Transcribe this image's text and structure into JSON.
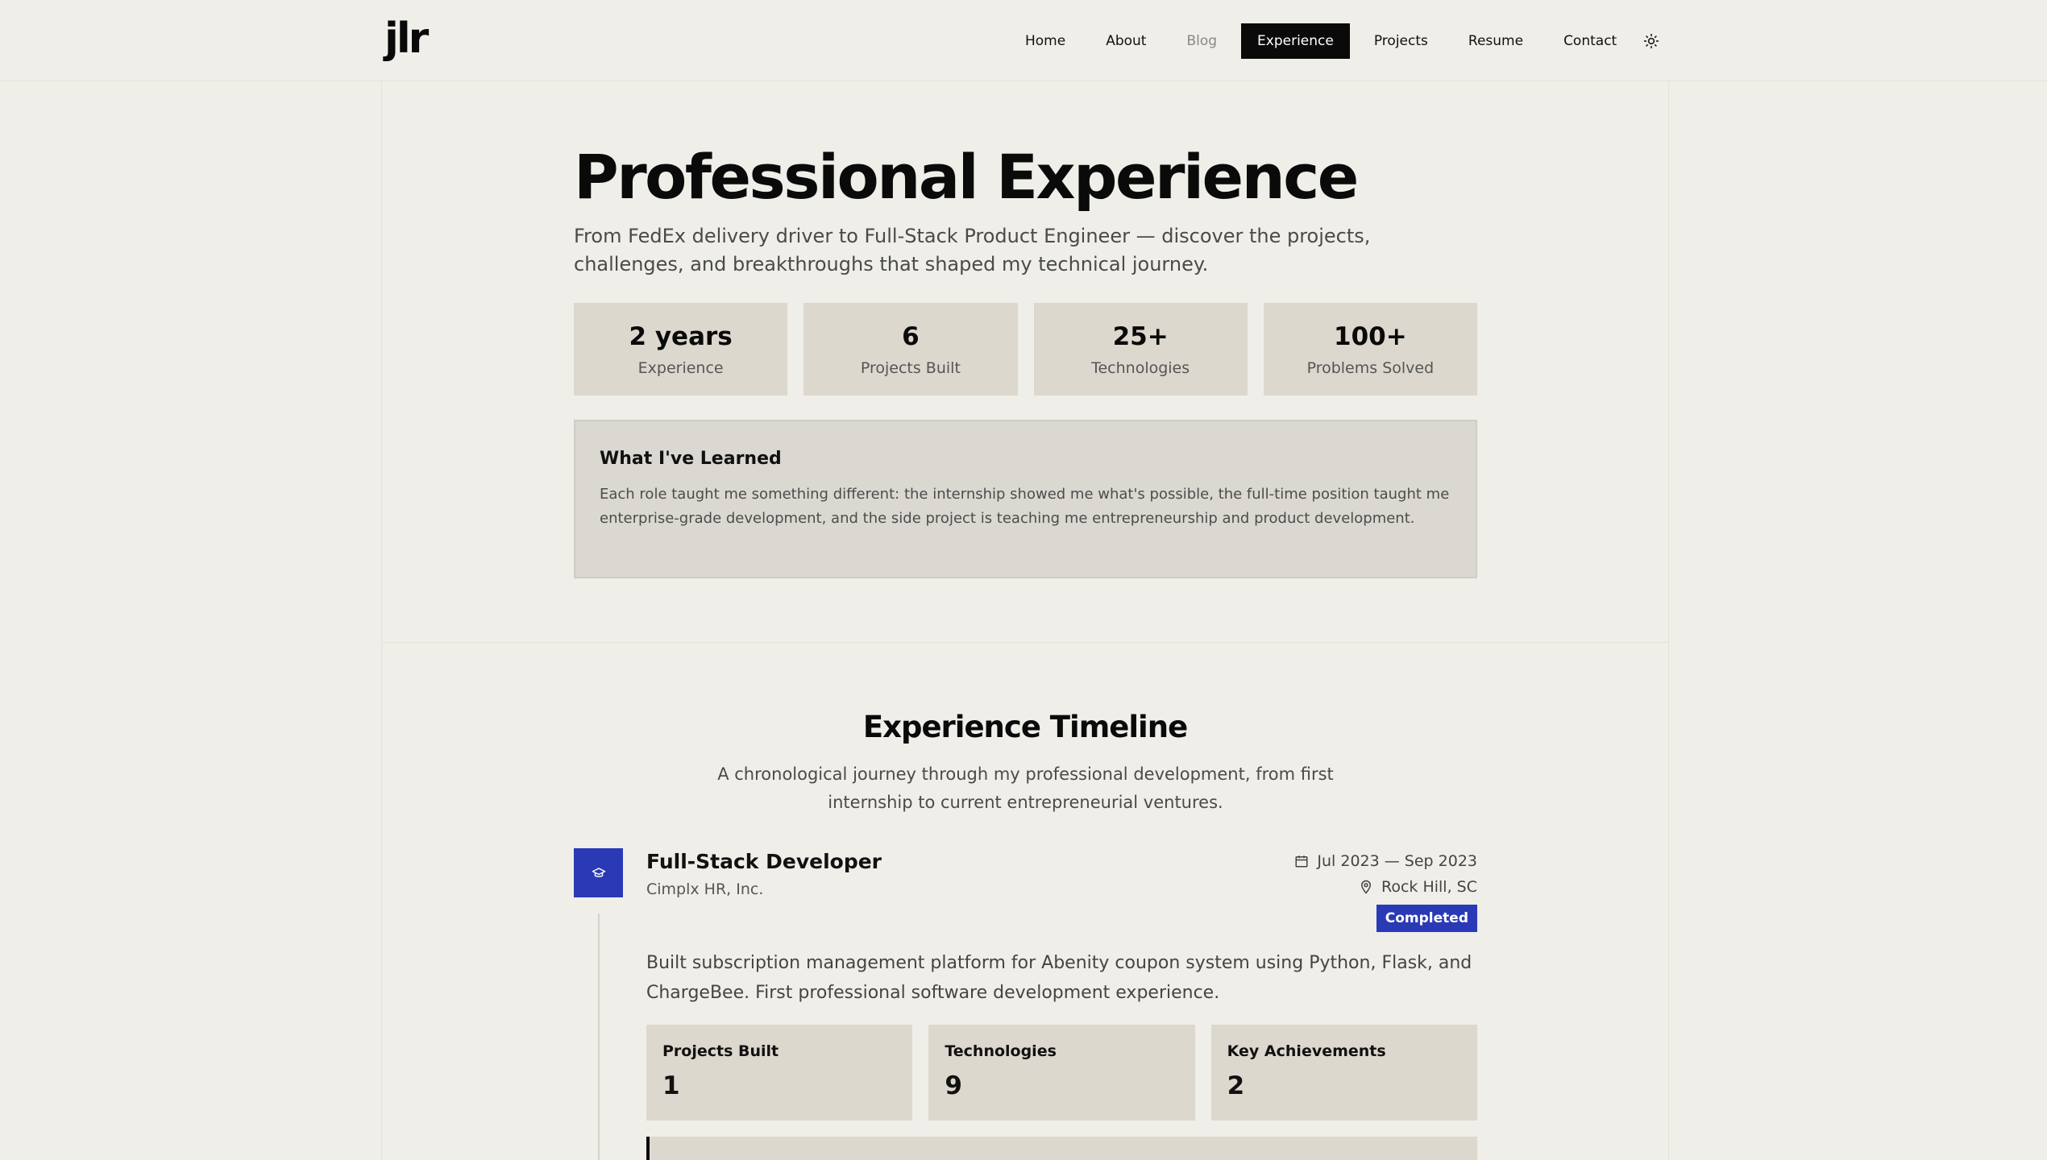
{
  "logo": "jlr",
  "nav": {
    "items": [
      {
        "label": "Home"
      },
      {
        "label": "About"
      },
      {
        "label": "Blog"
      },
      {
        "label": "Experience"
      },
      {
        "label": "Projects"
      },
      {
        "label": "Resume"
      },
      {
        "label": "Contact"
      }
    ],
    "active": "Experience",
    "theme_toggle_icon": "sun-icon"
  },
  "hero": {
    "title": "Professional Experience",
    "subtitle": "From FedEx delivery driver to Full-Stack Product Engineer — discover the projects, challenges, and breakthroughs that shaped my technical journey."
  },
  "stats": [
    {
      "value": "2 years",
      "label": "Experience"
    },
    {
      "value": "6",
      "label": "Projects Built"
    },
    {
      "value": "25+",
      "label": "Technologies"
    },
    {
      "value": "100+",
      "label": "Problems Solved"
    }
  ],
  "learned": {
    "title": "What I've Learned",
    "body": "Each role taught me something different: the internship showed me what's possible, the full-time position taught me enterprise-grade development, and the side project is teaching me entrepreneurship and product development."
  },
  "timeline": {
    "title": "Experience Timeline",
    "subtitle": "A chronological journey through my professional development, from first internship to current entrepreneurial ventures.",
    "entries": [
      {
        "icon": "graduation-cap-icon",
        "title": "Full-Stack Developer",
        "company": "Cimplx HR, Inc.",
        "dates": "Jul 2023 — Sep 2023",
        "location": "Rock Hill, SC",
        "status": "Completed",
        "description": "Built subscription management platform for Abenity coupon system using Python, Flask, and ChargeBee. First professional software development experience.",
        "metrics": [
          {
            "label": "Projects Built",
            "value": "1"
          },
          {
            "label": "Technologies",
            "value": "9"
          },
          {
            "label": "Key Achievements",
            "value": "2"
          }
        ]
      }
    ]
  },
  "colors": {
    "background": "#efeee8",
    "card": "#dcd8ce",
    "accent": "#2a3ab6",
    "nav_active_bg": "#0a0a0a"
  }
}
